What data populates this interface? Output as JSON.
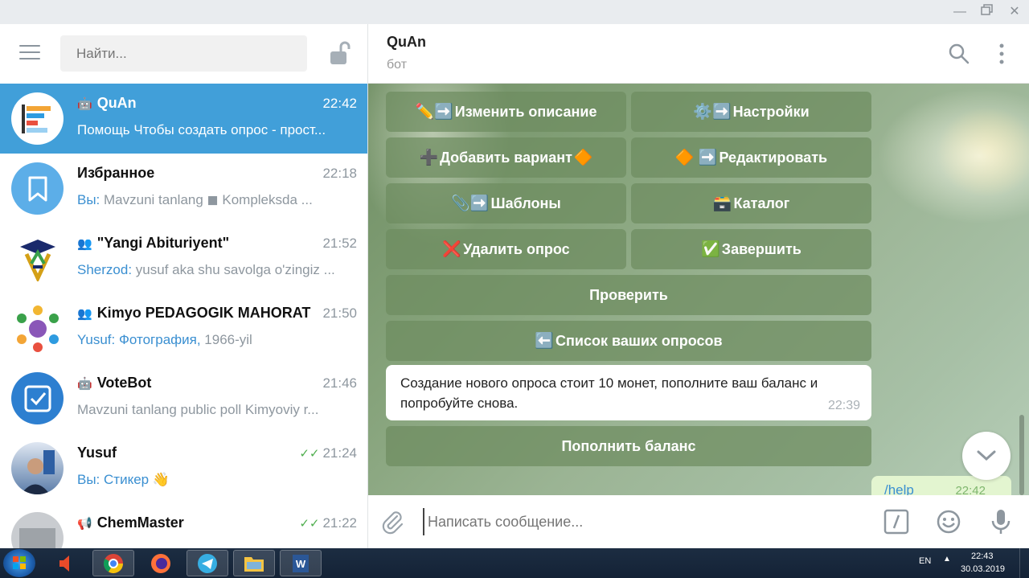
{
  "window": {
    "minimize_icon": "minimize-icon",
    "maximize_icon": "maximize-icon",
    "close_icon": "close-icon"
  },
  "sidebar": {
    "search_placeholder": "Найти...",
    "chats": [
      {
        "title": "QuAn",
        "type": "bot",
        "time": "22:42",
        "sender": "",
        "preview": "Помощь  Чтобы создать опрос - прост...",
        "active": true
      },
      {
        "title": "Избранное",
        "type": "saved",
        "time": "22:18",
        "sender": "Вы:",
        "preview": "Mavzuni tanlang  ◼  Kompleksda ..."
      },
      {
        "title": "\"Yangi Abituriyent\"",
        "type": "group",
        "time": "21:52",
        "sender": "Sherzod:",
        "preview": "yusuf aka shu savolga o'zingiz ..."
      },
      {
        "title": "Kimyo PEDAGOGIK MAHORAT",
        "type": "group",
        "time": "21:50",
        "sender": "Yusuf: Фотография,",
        "preview": "1966-yil"
      },
      {
        "title": "VoteBot",
        "type": "bot",
        "time": "21:46",
        "sender": "",
        "preview": "Mavzuni tanlang public poll  Kimyoviy r..."
      },
      {
        "title": "Yusuf",
        "type": "user",
        "time": "21:24",
        "sender": "Вы: Стикер",
        "preview": "👋"
      },
      {
        "title": "ChemMaster",
        "type": "channel",
        "time": "21:22",
        "sender": "",
        "preview": ""
      }
    ]
  },
  "chat": {
    "peer_name": "QuAn",
    "peer_status": "бот",
    "keyboard": [
      {
        "emoji_pre": "✏️➡️",
        "label": "Изменить описание",
        "emoji_post": ""
      },
      {
        "emoji_pre": "⚙️➡️",
        "label": "Настройки",
        "emoji_post": ""
      },
      {
        "emoji_pre": "➕",
        "label": "Добавить вариант",
        "emoji_post": "🔶"
      },
      {
        "emoji_pre": "🔶 ➡️",
        "label": "Редактировать",
        "emoji_post": ""
      },
      {
        "emoji_pre": "📎➡️",
        "label": "Шаблоны",
        "emoji_post": ""
      },
      {
        "emoji_pre": "🗃️",
        "label": "Каталог",
        "emoji_post": ""
      },
      {
        "emoji_pre": "❌ ",
        "label": "Удалить опрос",
        "emoji_post": ""
      },
      {
        "emoji_pre": "✅",
        "label": "Завершить",
        "emoji_post": ""
      },
      {
        "emoji_pre": "",
        "label": "Проверить",
        "emoji_post": ""
      },
      {
        "emoji_pre": "⬅️",
        "label": "Список ваших опросов",
        "emoji_post": ""
      }
    ],
    "message": {
      "text": "Создание нового опроса стоит 10 монет, пополните ваш баланс и попробуйте снова.",
      "time": "22:39"
    },
    "topup_button": "Пополнить баланс",
    "outgoing": {
      "text": "/help",
      "time": "22:42"
    },
    "composer_placeholder": "Написать сообщение..."
  },
  "taskbar": {
    "lang": "EN",
    "time": "22:43",
    "date": "30.03.2019"
  },
  "colors": {
    "accent": "#419fd9",
    "link": "#3a8fd1",
    "keyboard_button": "#6e8c5f"
  }
}
